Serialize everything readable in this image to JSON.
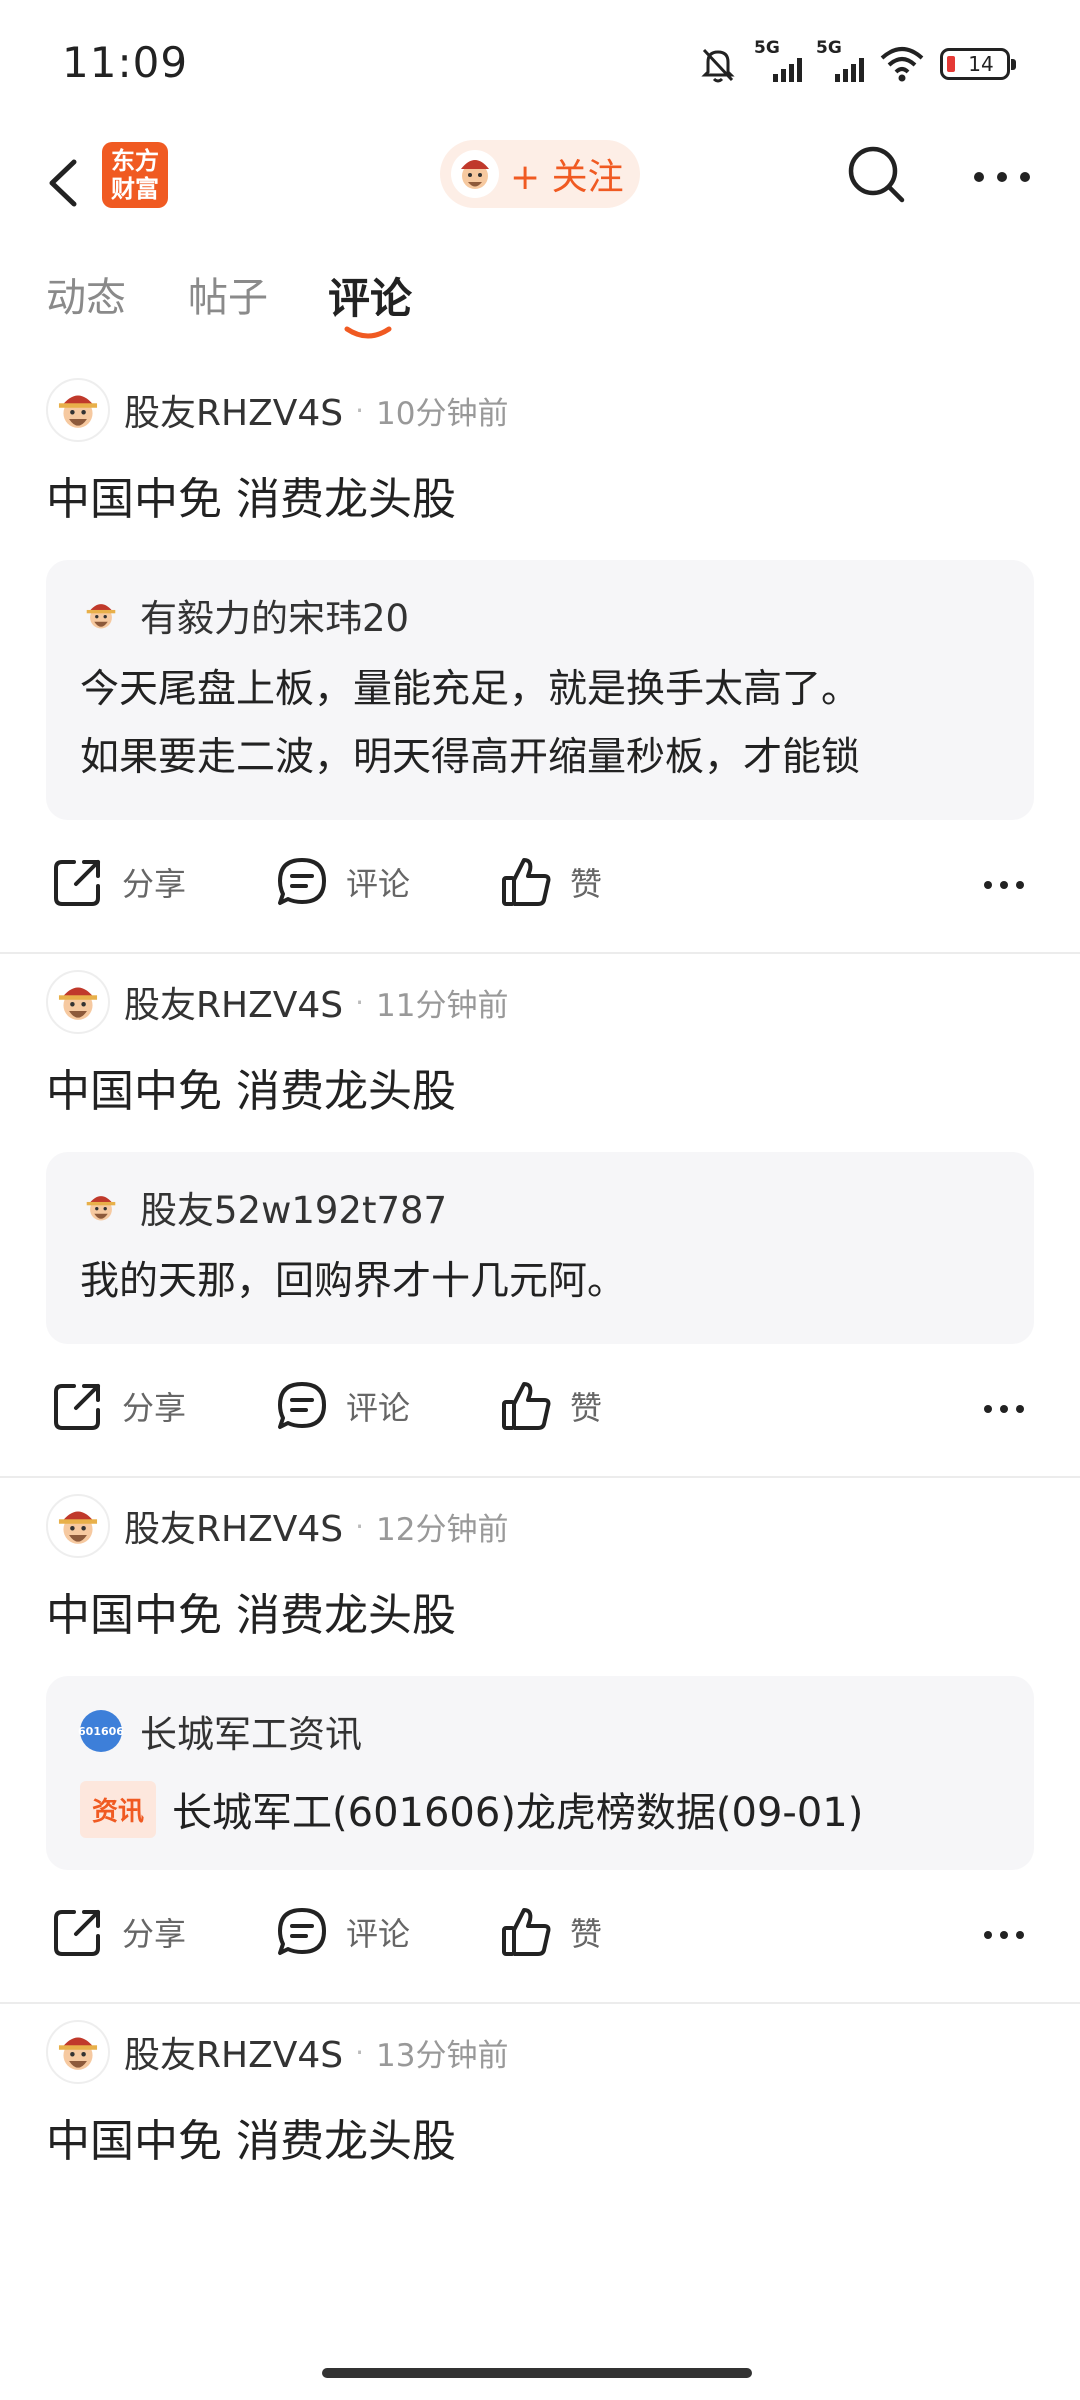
{
  "status_bar": {
    "time": "11:09",
    "network_1": "5G",
    "network_2": "5G",
    "battery": "14"
  },
  "header": {
    "logo_line1": "东方",
    "logo_line2": "财富",
    "follow_label": "+ 关注"
  },
  "tabs": [
    {
      "label": "动态"
    },
    {
      "label": "帖子"
    },
    {
      "label": "评论"
    }
  ],
  "action_labels": {
    "share": "分享",
    "comment": "评论",
    "like": "赞"
  },
  "posts": [
    {
      "user": "股友RHZV4S",
      "time": "10分钟前",
      "title": "中国中免 消费龙头股",
      "quote": {
        "user": "有毅力的宋玮20",
        "lines": [
          "今天尾盘上板，量能充足，就是换手太高了。",
          "如果要走二波，明天得高开缩量秒板，才能锁"
        ]
      }
    },
    {
      "user": "股友RHZV4S",
      "time": "11分钟前",
      "title": "中国中免 消费龙头股",
      "quote": {
        "user": "股友52w192t787",
        "lines": [
          "我的天那，回购界才十几元阿。"
        ]
      }
    },
    {
      "user": "股友RHZV4S",
      "time": "12分钟前",
      "title": "中国中免 消费龙头股",
      "quote": {
        "user": "长城军工资讯",
        "avatar_text": "601606",
        "badge": "资讯",
        "news": "长城军工(601606)龙虎榜数据(09-01)"
      }
    },
    {
      "user": "股友RHZV4S",
      "time": "13分钟前",
      "title": "中国中免 消费龙头股"
    }
  ]
}
